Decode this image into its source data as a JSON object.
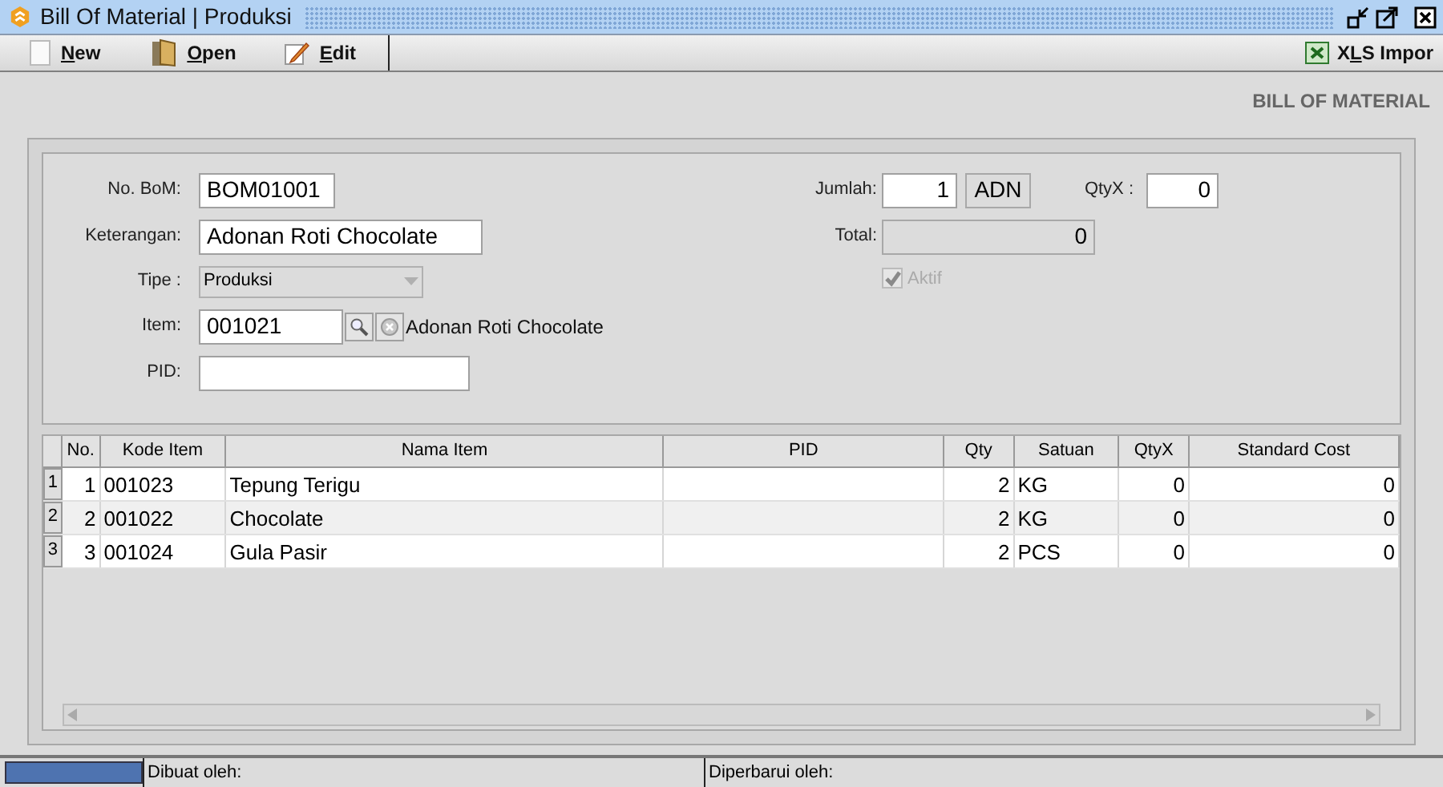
{
  "window": {
    "title": "Bill Of Material | Produksi"
  },
  "toolbar": [
    {
      "kind": "new",
      "key": "N",
      "post": "ew"
    },
    {
      "kind": "open",
      "key": "O",
      "post": "pen"
    },
    {
      "kind": "edit",
      "key": "E",
      "post": "dit"
    }
  ],
  "import_button": {
    "pre": "X",
    "key": "L",
    "post": "S Impor"
  },
  "heading": "BILL OF MATERIAL",
  "form": {
    "no_bom": {
      "label": "No. BoM:",
      "value": "BOM01001"
    },
    "keterangan": {
      "label": "Keterangan:",
      "value": "Adonan Roti Chocolate"
    },
    "tipe": {
      "label": "Tipe :",
      "value": "Produksi"
    },
    "item": {
      "label": "Item:",
      "value": "001021",
      "name": "Adonan Roti Chocolate"
    },
    "pid": {
      "label": "PID:"
    },
    "jumlah": {
      "label": "Jumlah:",
      "value": "1",
      "unit": "ADN"
    },
    "qtyx": {
      "label": "QtyX :",
      "value": "0"
    },
    "total": {
      "label": "Total:",
      "value": "0"
    },
    "aktif": {
      "label": "Aktif",
      "checked": true,
      "disabled": true
    }
  },
  "table": {
    "columns": [
      "No.",
      "Kode Item",
      "Nama Item",
      "PID",
      "Qty",
      "Satuan",
      "QtyX",
      "Standard Cost"
    ],
    "rows": [
      {
        "header": "1",
        "cells": [
          "1",
          "001023",
          "Tepung Terigu",
          "",
          "2",
          "KG",
          "0",
          "0"
        ]
      },
      {
        "header": "2",
        "cells": [
          "2",
          "001022",
          "Chocolate",
          "",
          "2",
          "KG",
          "0",
          "0"
        ]
      },
      {
        "header": "3",
        "cells": [
          "3",
          "001024",
          "Gula Pasir",
          "",
          "2",
          "PCS",
          "0",
          "0"
        ]
      }
    ]
  },
  "status_bar": {
    "created": "Dibuat oleh:",
    "updated": "Diperbarui oleh:"
  }
}
